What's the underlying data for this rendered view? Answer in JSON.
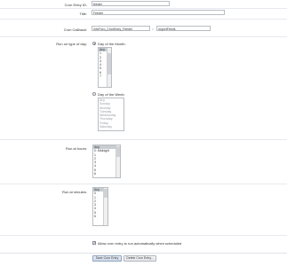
{
  "fields": {
    "cron_id_label": "Cron Entry ID:",
    "cron_id_value": "feeder",
    "title_label": "Title:",
    "title_value": "Feeder",
    "callback_label": "Cron Callback:",
    "callback_class": "XenForo_CronEntry_Feeder",
    "callback_sep": "::",
    "callback_method": "importFeeds"
  },
  "run_type": {
    "label": "Run on type of day:",
    "month_option": "Day of the Month:",
    "week_option": "Day of the Week:",
    "month_days": [
      "Any",
      "1",
      "2",
      "3",
      "4",
      "5",
      "6",
      "7"
    ],
    "week_days": [
      "Any",
      "Sunday",
      "Monday",
      "Tuesday",
      "Wednesday",
      "Thursday",
      "Friday",
      "Saturday"
    ]
  },
  "hours": {
    "label": "Run at hours:",
    "options": [
      "Any",
      "0: Midnight",
      "1",
      "2",
      "3",
      "4",
      "5",
      "6"
    ]
  },
  "minutes": {
    "label": "Run at minutes:",
    "options": [
      "Any",
      "0",
      "1",
      "2",
      "3",
      "4",
      "5",
      "6"
    ]
  },
  "options": {
    "active_label": "Allow cron entry to run automatically when scheduled"
  },
  "buttons": {
    "save": "Save Cron Entry",
    "delete": "Delete Cron Entry..."
  }
}
